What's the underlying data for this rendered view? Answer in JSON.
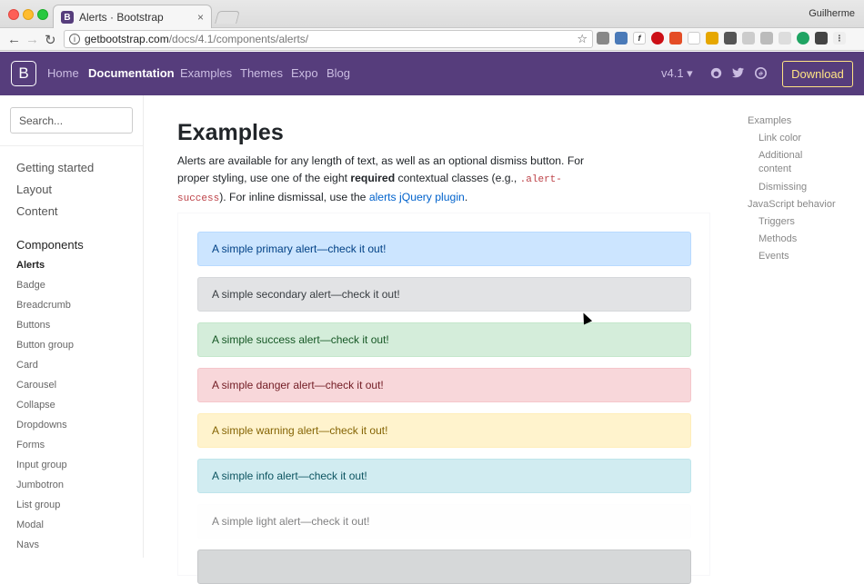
{
  "browser": {
    "tab_title": "Alerts · Bootstrap",
    "tab_favicon": "B",
    "tab_close": "×",
    "profile_name": "Guilherme",
    "url_host": "getbootstrap.com",
    "url_path": "/docs/4.1/components/alerts/",
    "back_icon": "←",
    "forward_icon": "→",
    "reload_icon": "↻",
    "info_icon": "i",
    "star_icon": "☆"
  },
  "navbar": {
    "brand": "B",
    "links": [
      "Home",
      "Documentation",
      "Examples",
      "Themes",
      "Expo",
      "Blog"
    ],
    "active_link": "Documentation",
    "version": "v4.1 ▾",
    "download_label": "Download",
    "bg_color": "#563d7c",
    "download_color": "#ffe484"
  },
  "sidebar": {
    "search_placeholder": "Search...",
    "groups": [
      "Getting started",
      "Layout",
      "Content",
      "Components"
    ],
    "items": [
      "Alerts",
      "Badge",
      "Breadcrumb",
      "Buttons",
      "Button group",
      "Card",
      "Carousel",
      "Collapse",
      "Dropdowns",
      "Forms",
      "Input group",
      "Jumbotron",
      "List group",
      "Modal",
      "Navs"
    ],
    "active_item": "Alerts"
  },
  "main": {
    "title": "Examples",
    "intro_part1": "Alerts are available for any length of text, as well as an optional dismiss button. For proper styling, use one of the eight ",
    "intro_bold": "required",
    "intro_part2": " contextual classes (e.g., ",
    "intro_code": ".alert-success",
    "intro_part3": "). For inline dismissal, use the ",
    "intro_link": "alerts jQuery plugin",
    "intro_part4": ".",
    "alerts": [
      {
        "text": "A simple primary alert—check it out!",
        "bg": "#cce5ff",
        "border": "#b8daff",
        "color": "#004085"
      },
      {
        "text": "A simple secondary alert—check it out!",
        "bg": "#e2e3e5",
        "border": "#d6d8db",
        "color": "#383d41"
      },
      {
        "text": "A simple success alert—check it out!",
        "bg": "#d4edda",
        "border": "#c3e6cb",
        "color": "#155724"
      },
      {
        "text": "A simple danger alert—check it out!",
        "bg": "#f8d7da",
        "border": "#f5c6cb",
        "color": "#721c24"
      },
      {
        "text": "A simple warning alert—check it out!",
        "bg": "#fff3cd",
        "border": "#ffeeba",
        "color": "#856404"
      },
      {
        "text": "A simple info alert—check it out!",
        "bg": "#d1ecf1",
        "border": "#bee5eb",
        "color": "#0c5460"
      },
      {
        "text": "A simple light alert—check it out!",
        "bg": "#fefefe",
        "border": "#fdfdfe",
        "color": "#818182"
      }
    ]
  },
  "toc": {
    "items": [
      {
        "label": "Examples",
        "level": "top"
      },
      {
        "label": "Link color",
        "level": "sub"
      },
      {
        "label": "Additional content",
        "level": "sub"
      },
      {
        "label": "Dismissing",
        "level": "sub"
      },
      {
        "label": "JavaScript behavior",
        "level": "top"
      },
      {
        "label": "Triggers",
        "level": "sub"
      },
      {
        "label": "Methods",
        "level": "sub"
      },
      {
        "label": "Events",
        "level": "sub"
      }
    ]
  }
}
